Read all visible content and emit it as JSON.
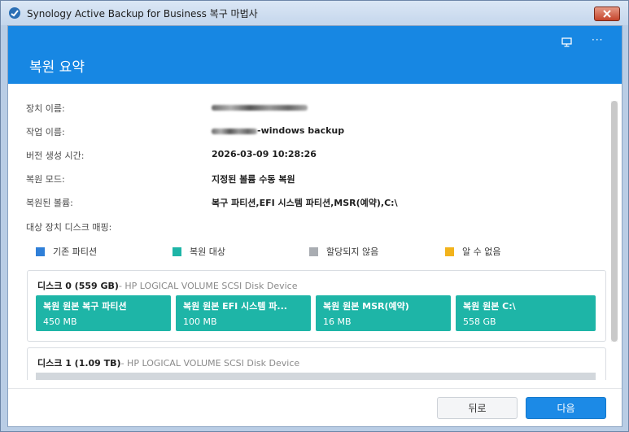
{
  "window": {
    "title": "Synology Active Backup for Business 복구 마법사"
  },
  "header": {
    "title": "복원 요약"
  },
  "summary": {
    "device_name_label": "장치 이름:",
    "task_name_label": "작업 이름:",
    "task_name_suffix": "-windows backup",
    "version_time_label": "버전 생성 시간:",
    "version_time_value": "2026-03-09 10:28:26",
    "restore_mode_label": "복원 모드:",
    "restore_mode_value": "지정된 볼륨 수동 복원",
    "restored_volumes_label": "복원된 볼륨:",
    "restored_volumes_value": "복구 파티션,EFI 시스템 파티션,MSR(예약),C:\\",
    "disk_mapping_label": "대상 장치 디스크 매핑:"
  },
  "legend": [
    {
      "label": "기존 파티션",
      "color": "#2f7fd8"
    },
    {
      "label": "복원 대상",
      "color": "#1eb5a7"
    },
    {
      "label": "할당되지 않음",
      "color": "#a9adb2"
    },
    {
      "label": "알 수 없음",
      "color": "#f2b31c"
    }
  ],
  "disks": [
    {
      "name": "디스크 0 (559 GB)",
      "model": "- HP LOGICAL VOLUME SCSI Disk Device",
      "partitions": [
        {
          "name": "복원 원본 복구 파티션",
          "size": "450 MB"
        },
        {
          "name": "복원 원본 EFI 시스템 파...",
          "size": "100 MB"
        },
        {
          "name": "복원 원본 MSR(예약)",
          "size": "16 MB"
        },
        {
          "name": "복원 원본 C:\\",
          "size": "558 GB"
        }
      ]
    },
    {
      "name": "디스크 1 (1.09 TB)",
      "model": "- HP LOGICAL VOLUME SCSI Disk Device"
    }
  ],
  "buttons": {
    "back": "뒤로",
    "next": "다음"
  },
  "colors": {
    "accent": "#1787e3",
    "restore_target": "#1eb5a7"
  }
}
